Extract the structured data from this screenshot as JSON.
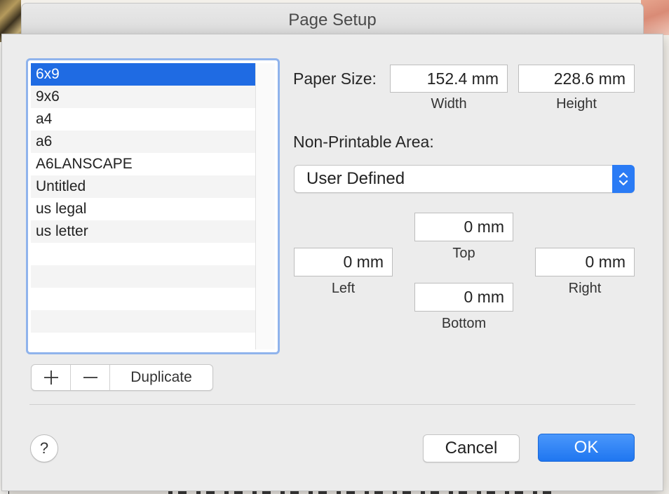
{
  "window": {
    "title": "Page Setup"
  },
  "paper_list": {
    "items": [
      "6x9",
      "9x6",
      "a4",
      "a6",
      "A6LANSCAPE",
      "Untitled",
      "us legal",
      "us letter",
      "",
      "",
      "",
      "",
      ""
    ],
    "selected_index": 0
  },
  "list_buttons": {
    "duplicate_label": "Duplicate"
  },
  "paper_size": {
    "label": "Paper Size:",
    "width_value": "152.4 mm",
    "width_label": "Width",
    "height_value": "228.6 mm",
    "height_label": "Height"
  },
  "non_printable": {
    "label": "Non-Printable Area:",
    "selected_option": "User Defined",
    "top_value": "0 mm",
    "top_label": "Top",
    "left_value": "0 mm",
    "left_label": "Left",
    "right_value": "0 mm",
    "right_label": "Right",
    "bottom_value": "0 mm",
    "bottom_label": "Bottom"
  },
  "footer": {
    "help_label": "?",
    "cancel_label": "Cancel",
    "ok_label": "OK"
  },
  "colors": {
    "accent": "#1f6be3",
    "focus_ring": "#8fb3ec",
    "ok_button": "#2a7bf5"
  },
  "icons": {
    "add": "plus-icon",
    "remove": "minus-icon",
    "popup": "up-down-chevron-icon"
  }
}
